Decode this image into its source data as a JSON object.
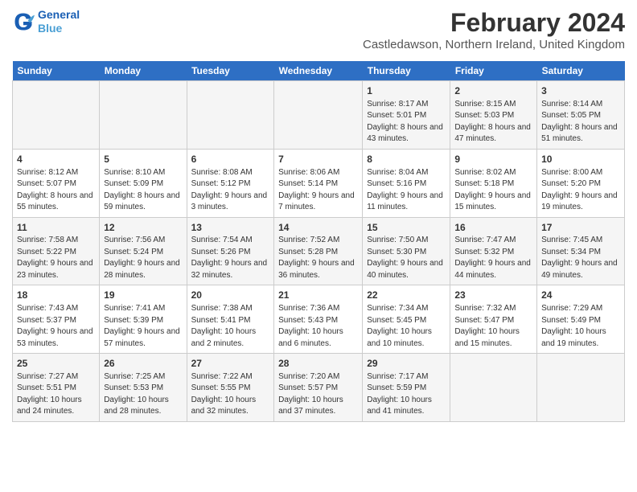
{
  "app": {
    "logo_line1": "General",
    "logo_line2": "Blue"
  },
  "header": {
    "title": "February 2024",
    "subtitle": "Castledawson, Northern Ireland, United Kingdom"
  },
  "calendar": {
    "days_of_week": [
      "Sunday",
      "Monday",
      "Tuesday",
      "Wednesday",
      "Thursday",
      "Friday",
      "Saturday"
    ],
    "weeks": [
      [
        {
          "day": "",
          "content": ""
        },
        {
          "day": "",
          "content": ""
        },
        {
          "day": "",
          "content": ""
        },
        {
          "day": "",
          "content": ""
        },
        {
          "day": "1",
          "content": "Sunrise: 8:17 AM\nSunset: 5:01 PM\nDaylight: 8 hours and 43 minutes."
        },
        {
          "day": "2",
          "content": "Sunrise: 8:15 AM\nSunset: 5:03 PM\nDaylight: 8 hours and 47 minutes."
        },
        {
          "day": "3",
          "content": "Sunrise: 8:14 AM\nSunset: 5:05 PM\nDaylight: 8 hours and 51 minutes."
        }
      ],
      [
        {
          "day": "4",
          "content": "Sunrise: 8:12 AM\nSunset: 5:07 PM\nDaylight: 8 hours and 55 minutes."
        },
        {
          "day": "5",
          "content": "Sunrise: 8:10 AM\nSunset: 5:09 PM\nDaylight: 8 hours and 59 minutes."
        },
        {
          "day": "6",
          "content": "Sunrise: 8:08 AM\nSunset: 5:12 PM\nDaylight: 9 hours and 3 minutes."
        },
        {
          "day": "7",
          "content": "Sunrise: 8:06 AM\nSunset: 5:14 PM\nDaylight: 9 hours and 7 minutes."
        },
        {
          "day": "8",
          "content": "Sunrise: 8:04 AM\nSunset: 5:16 PM\nDaylight: 9 hours and 11 minutes."
        },
        {
          "day": "9",
          "content": "Sunrise: 8:02 AM\nSunset: 5:18 PM\nDaylight: 9 hours and 15 minutes."
        },
        {
          "day": "10",
          "content": "Sunrise: 8:00 AM\nSunset: 5:20 PM\nDaylight: 9 hours and 19 minutes."
        }
      ],
      [
        {
          "day": "11",
          "content": "Sunrise: 7:58 AM\nSunset: 5:22 PM\nDaylight: 9 hours and 23 minutes."
        },
        {
          "day": "12",
          "content": "Sunrise: 7:56 AM\nSunset: 5:24 PM\nDaylight: 9 hours and 28 minutes."
        },
        {
          "day": "13",
          "content": "Sunrise: 7:54 AM\nSunset: 5:26 PM\nDaylight: 9 hours and 32 minutes."
        },
        {
          "day": "14",
          "content": "Sunrise: 7:52 AM\nSunset: 5:28 PM\nDaylight: 9 hours and 36 minutes."
        },
        {
          "day": "15",
          "content": "Sunrise: 7:50 AM\nSunset: 5:30 PM\nDaylight: 9 hours and 40 minutes."
        },
        {
          "day": "16",
          "content": "Sunrise: 7:47 AM\nSunset: 5:32 PM\nDaylight: 9 hours and 44 minutes."
        },
        {
          "day": "17",
          "content": "Sunrise: 7:45 AM\nSunset: 5:34 PM\nDaylight: 9 hours and 49 minutes."
        }
      ],
      [
        {
          "day": "18",
          "content": "Sunrise: 7:43 AM\nSunset: 5:37 PM\nDaylight: 9 hours and 53 minutes."
        },
        {
          "day": "19",
          "content": "Sunrise: 7:41 AM\nSunset: 5:39 PM\nDaylight: 9 hours and 57 minutes."
        },
        {
          "day": "20",
          "content": "Sunrise: 7:38 AM\nSunset: 5:41 PM\nDaylight: 10 hours and 2 minutes."
        },
        {
          "day": "21",
          "content": "Sunrise: 7:36 AM\nSunset: 5:43 PM\nDaylight: 10 hours and 6 minutes."
        },
        {
          "day": "22",
          "content": "Sunrise: 7:34 AM\nSunset: 5:45 PM\nDaylight: 10 hours and 10 minutes."
        },
        {
          "day": "23",
          "content": "Sunrise: 7:32 AM\nSunset: 5:47 PM\nDaylight: 10 hours and 15 minutes."
        },
        {
          "day": "24",
          "content": "Sunrise: 7:29 AM\nSunset: 5:49 PM\nDaylight: 10 hours and 19 minutes."
        }
      ],
      [
        {
          "day": "25",
          "content": "Sunrise: 7:27 AM\nSunset: 5:51 PM\nDaylight: 10 hours and 24 minutes."
        },
        {
          "day": "26",
          "content": "Sunrise: 7:25 AM\nSunset: 5:53 PM\nDaylight: 10 hours and 28 minutes."
        },
        {
          "day": "27",
          "content": "Sunrise: 7:22 AM\nSunset: 5:55 PM\nDaylight: 10 hours and 32 minutes."
        },
        {
          "day": "28",
          "content": "Sunrise: 7:20 AM\nSunset: 5:57 PM\nDaylight: 10 hours and 37 minutes."
        },
        {
          "day": "29",
          "content": "Sunrise: 7:17 AM\nSunset: 5:59 PM\nDaylight: 10 hours and 41 minutes."
        },
        {
          "day": "",
          "content": ""
        },
        {
          "day": "",
          "content": ""
        }
      ]
    ]
  }
}
